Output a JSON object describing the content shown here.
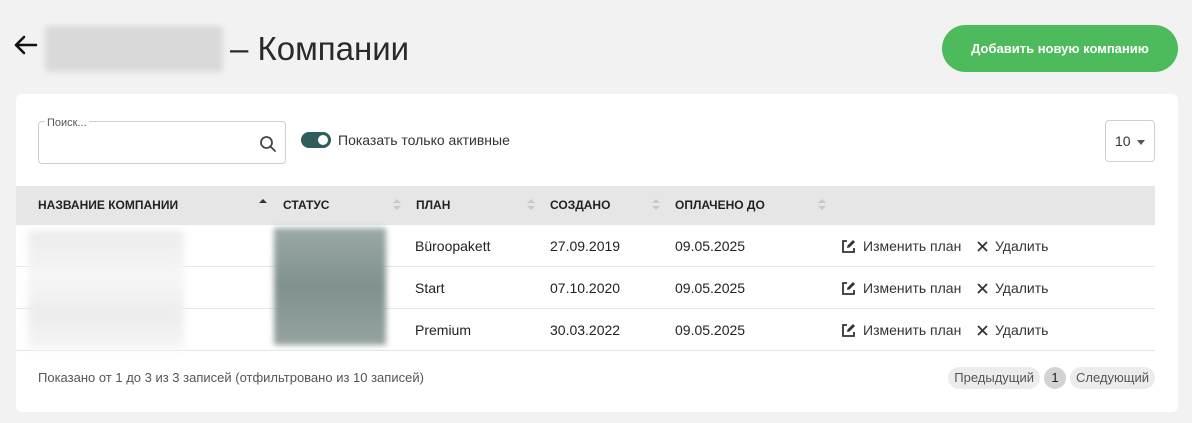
{
  "header": {
    "title": "– Компании",
    "add_button": "Добавить новую компанию"
  },
  "toolbar": {
    "search_label": "Поиск...",
    "search_value": "",
    "active_toggle_label": "Показать только активные",
    "active_toggle_on": true,
    "page_size": "10"
  },
  "table": {
    "columns": [
      "Название компании",
      "Статус",
      "План",
      "Создано",
      "Оплачено до"
    ],
    "sorted_column": "Название компании",
    "rows": [
      {
        "plan": "Büroopakett",
        "created": "27.09.2019",
        "paid_until": "09.05.2025",
        "edit": "Изменить план",
        "delete": "Удалить"
      },
      {
        "plan": "Start",
        "created": "07.10.2020",
        "paid_until": "09.05.2025",
        "edit": "Изменить план",
        "delete": "Удалить"
      },
      {
        "plan": "Premium",
        "created": "30.03.2022",
        "paid_until": "09.05.2025",
        "edit": "Изменить план",
        "delete": "Удалить"
      }
    ]
  },
  "footer": {
    "info": "Показано от 1 до 3 из 3 записей (отфильтровано из 10 записей)",
    "prev": "Предыдущий",
    "page": "1",
    "next": "Следующий"
  },
  "colors": {
    "accent_green": "#4dbb5b",
    "toggle_dark": "#2f5d5b"
  }
}
